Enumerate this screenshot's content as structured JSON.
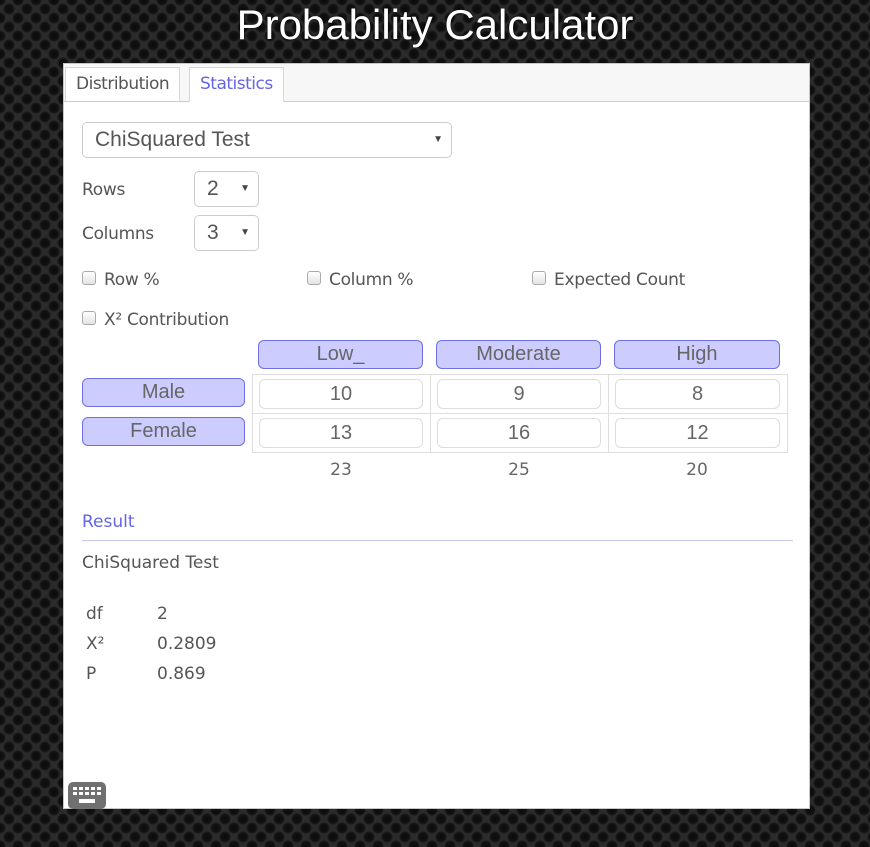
{
  "app": {
    "title": "Probability Calculator"
  },
  "tabs": [
    {
      "label": "Distribution",
      "active": false
    },
    {
      "label": "Statistics",
      "active": true
    }
  ],
  "test_select": {
    "value": "ChiSquared Test"
  },
  "rows": {
    "label": "Rows",
    "value": "2"
  },
  "columns": {
    "label": "Columns",
    "value": "3"
  },
  "checkboxes": [
    {
      "label": "Row %",
      "checked": false
    },
    {
      "label": "Column %",
      "checked": false
    },
    {
      "label": "Expected Count",
      "checked": false
    },
    {
      "label": "X² Contribution",
      "checked": false
    }
  ],
  "table": {
    "column_headers": [
      "Low_",
      "Moderate",
      "High"
    ],
    "row_headers": [
      "Male",
      "Female"
    ],
    "cells": [
      [
        "10",
        "9",
        "8"
      ],
      [
        "13",
        "16",
        "12"
      ]
    ],
    "column_totals": [
      "23",
      "25",
      "20"
    ]
  },
  "result": {
    "header": "Result",
    "title": "ChiSquared Test",
    "rows": [
      {
        "key": "df",
        "value": "2"
      },
      {
        "key": "X²",
        "value": "0.2809"
      },
      {
        "key": "P",
        "value": "0.869"
      }
    ]
  },
  "colors": {
    "accent": "#6464e6",
    "header_fill": "#ccccff"
  }
}
